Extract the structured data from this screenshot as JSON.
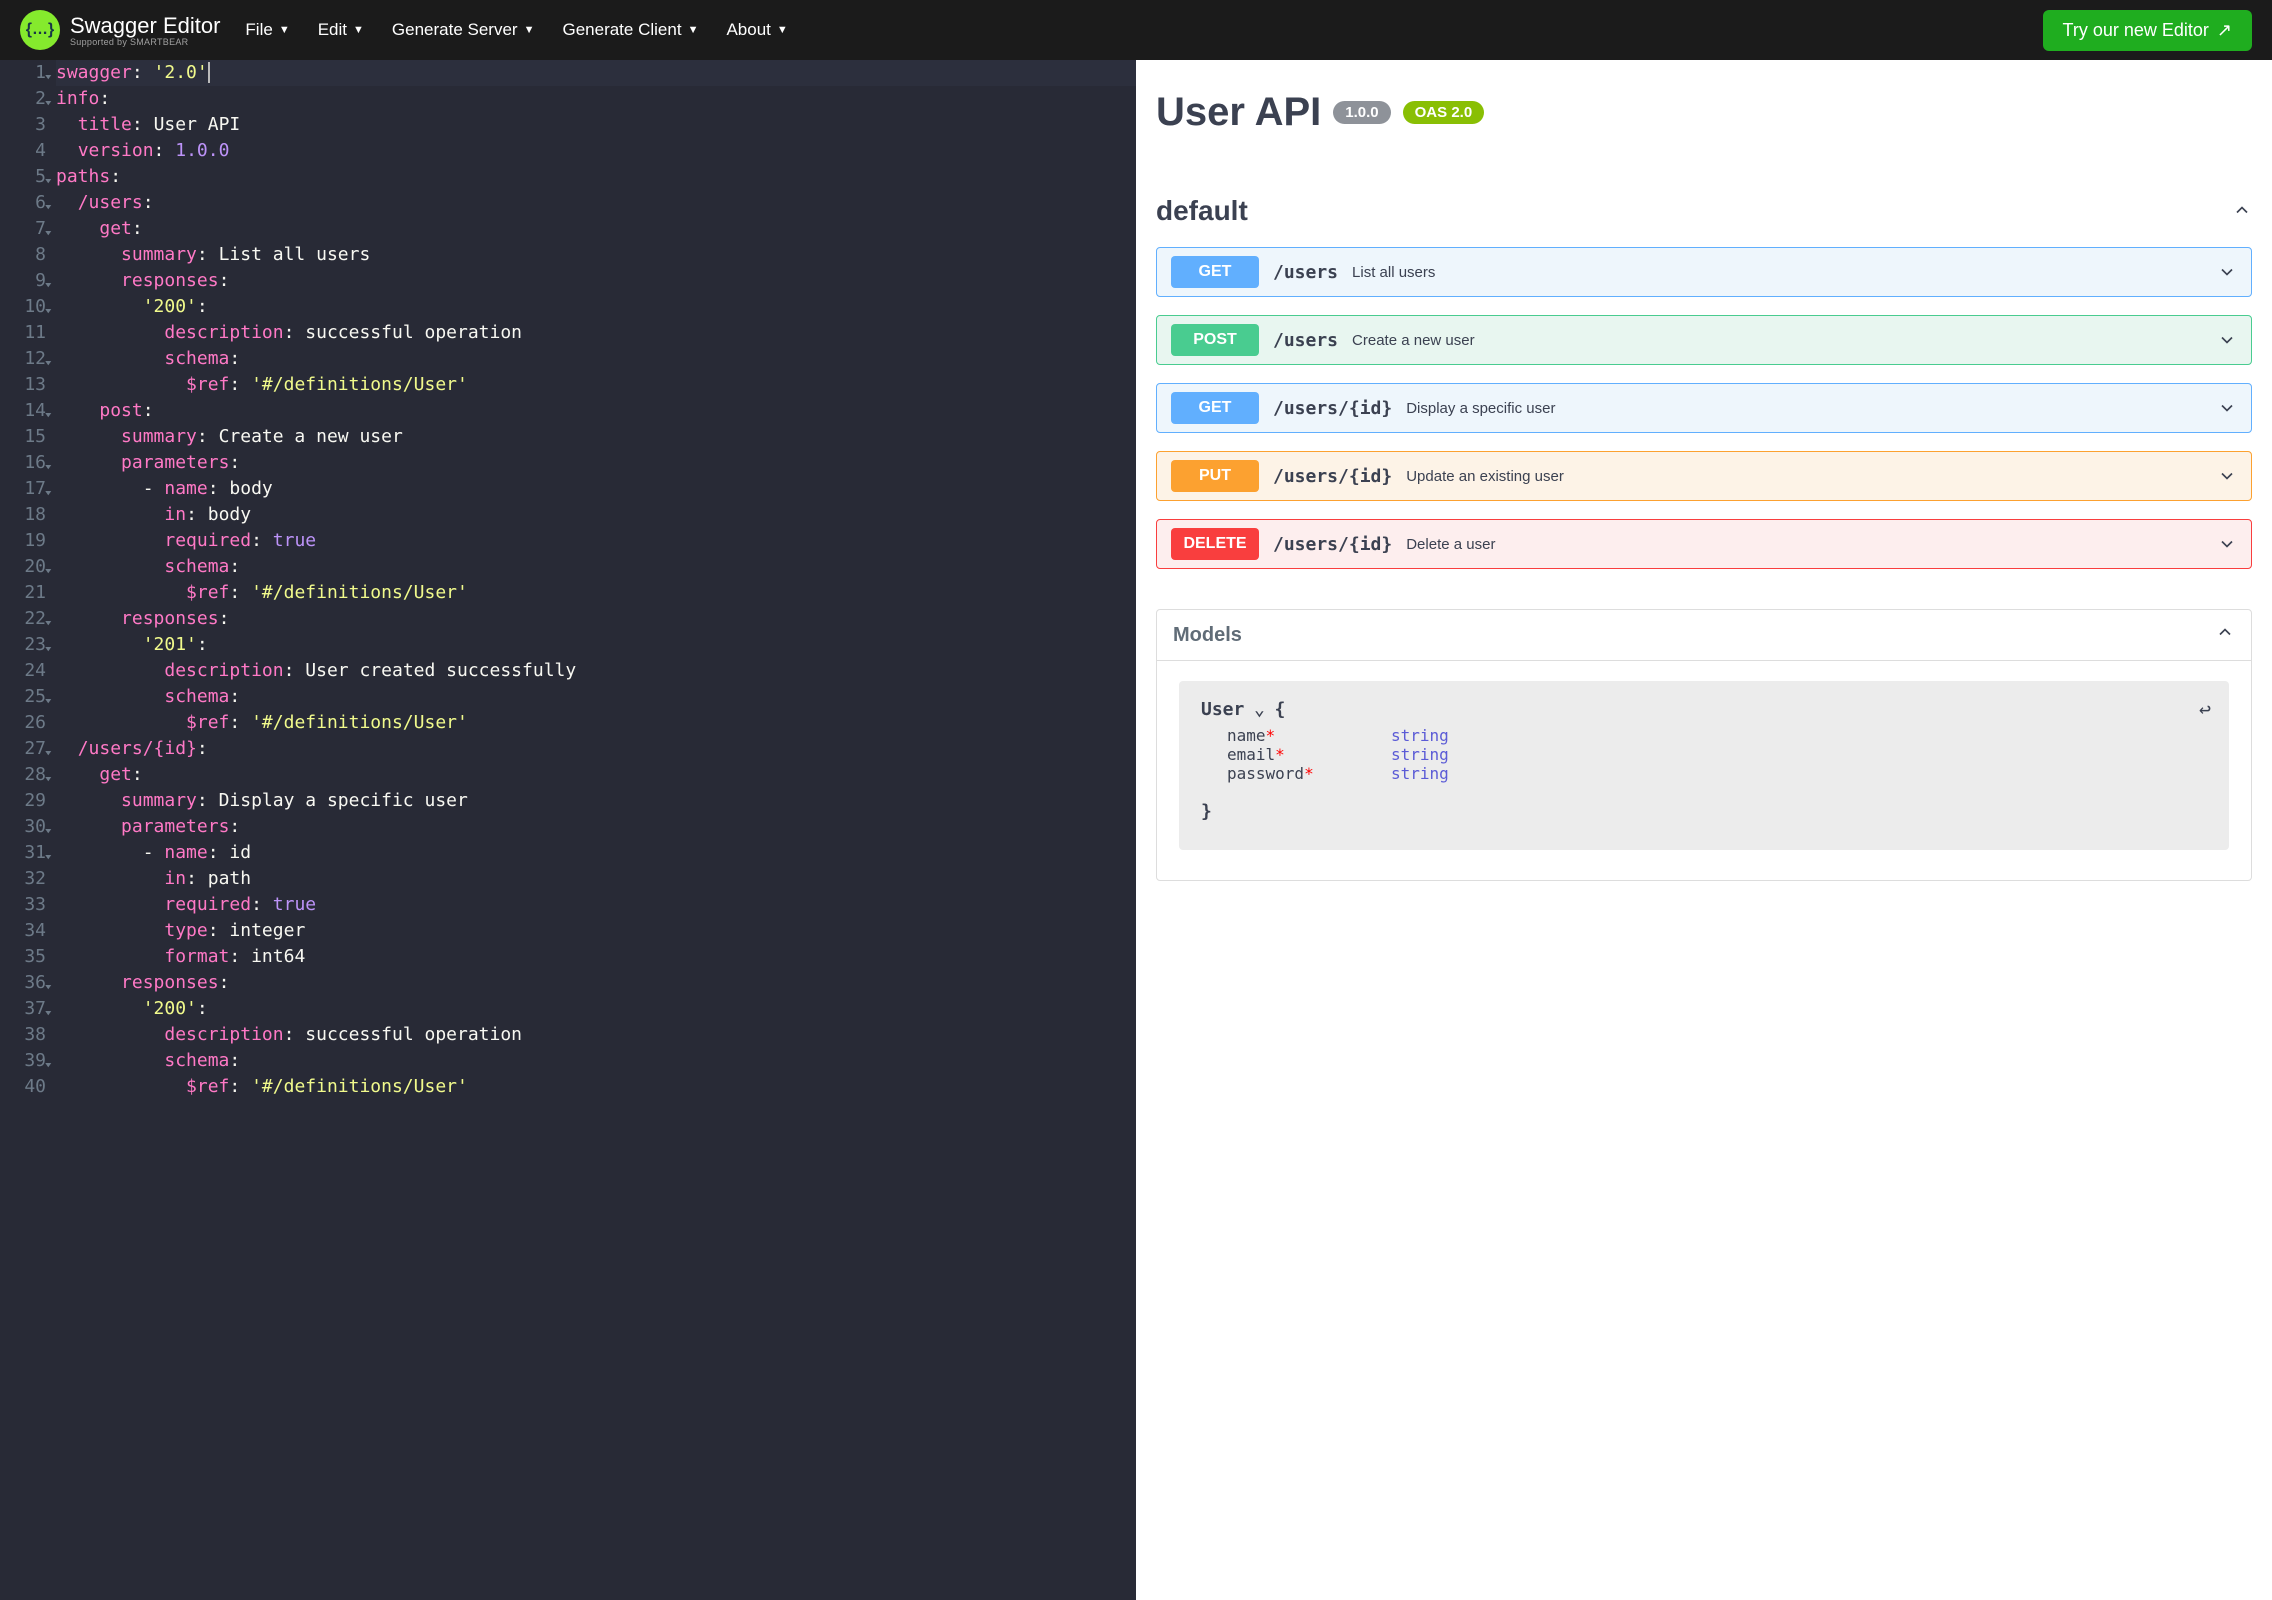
{
  "header": {
    "brand": "Swagger Editor",
    "brand_sub": "Supported by SMARTBEAR",
    "menu": [
      "File",
      "Edit",
      "Generate Server",
      "Generate Client",
      "About"
    ],
    "cta": "Try our new Editor"
  },
  "editor": {
    "lines": [
      {
        "n": 1,
        "f": 1,
        "h": 1,
        "html": "<span class='k'>swagger</span>: <span class='s'>'2.0'</span><span class='cursor'></span>"
      },
      {
        "n": 2,
        "f": 1,
        "html": "<span class='k'>info</span>:"
      },
      {
        "n": 3,
        "f": 0,
        "html": "  <span class='k'>title</span>: <span class='v'>User API</span>"
      },
      {
        "n": 4,
        "f": 0,
        "html": "  <span class='k'>version</span>: <span class='num'>1.0.0</span>"
      },
      {
        "n": 5,
        "f": 1,
        "html": "<span class='k'>paths</span>:"
      },
      {
        "n": 6,
        "f": 1,
        "html": "  <span class='k'>/users</span>:"
      },
      {
        "n": 7,
        "f": 1,
        "html": "    <span class='k'>get</span>:"
      },
      {
        "n": 8,
        "f": 0,
        "html": "      <span class='k'>summary</span>: <span class='v'>List all users</span>"
      },
      {
        "n": 9,
        "f": 1,
        "html": "      <span class='k'>responses</span>:"
      },
      {
        "n": 10,
        "f": 1,
        "html": "        <span class='s'>'200'</span>:"
      },
      {
        "n": 11,
        "f": 0,
        "html": "          <span class='k'>description</span>: <span class='v'>successful operation</span>"
      },
      {
        "n": 12,
        "f": 1,
        "html": "          <span class='k'>schema</span>:"
      },
      {
        "n": 13,
        "f": 0,
        "html": "            <span class='k'>$ref</span>: <span class='s'>'#/definitions/User'</span>"
      },
      {
        "n": 14,
        "f": 1,
        "html": "    <span class='k'>post</span>:"
      },
      {
        "n": 15,
        "f": 0,
        "html": "      <span class='k'>summary</span>: <span class='v'>Create a new user</span>"
      },
      {
        "n": 16,
        "f": 1,
        "html": "      <span class='k'>parameters</span>:"
      },
      {
        "n": 17,
        "f": 1,
        "html": "        - <span class='k'>name</span>: <span class='v'>body</span>"
      },
      {
        "n": 18,
        "f": 0,
        "html": "          <span class='k'>in</span>: <span class='v'>body</span>"
      },
      {
        "n": 19,
        "f": 0,
        "html": "          <span class='k'>required</span>: <span class='b'>true</span>"
      },
      {
        "n": 20,
        "f": 1,
        "html": "          <span class='k'>schema</span>:"
      },
      {
        "n": 21,
        "f": 0,
        "html": "            <span class='k'>$ref</span>: <span class='s'>'#/definitions/User'</span>"
      },
      {
        "n": 22,
        "f": 1,
        "html": "      <span class='k'>responses</span>:"
      },
      {
        "n": 23,
        "f": 1,
        "html": "        <span class='s'>'201'</span>:"
      },
      {
        "n": 24,
        "f": 0,
        "html": "          <span class='k'>description</span>: <span class='v'>User created successfully</span>"
      },
      {
        "n": 25,
        "f": 1,
        "html": "          <span class='k'>schema</span>:"
      },
      {
        "n": 26,
        "f": 0,
        "html": "            <span class='k'>$ref</span>: <span class='s'>'#/definitions/User'</span>"
      },
      {
        "n": 27,
        "f": 1,
        "html": "  <span class='k'>/users/{id}</span>:"
      },
      {
        "n": 28,
        "f": 1,
        "html": "    <span class='k'>get</span>:"
      },
      {
        "n": 29,
        "f": 0,
        "html": "      <span class='k'>summary</span>: <span class='v'>Display a specific user</span>"
      },
      {
        "n": 30,
        "f": 1,
        "html": "      <span class='k'>parameters</span>:"
      },
      {
        "n": 31,
        "f": 1,
        "html": "        - <span class='k'>name</span>: <span class='v'>id</span>"
      },
      {
        "n": 32,
        "f": 0,
        "html": "          <span class='k'>in</span>: <span class='v'>path</span>"
      },
      {
        "n": 33,
        "f": 0,
        "html": "          <span class='k'>required</span>: <span class='b'>true</span>"
      },
      {
        "n": 34,
        "f": 0,
        "html": "          <span class='k'>type</span>: <span class='v'>integer</span>"
      },
      {
        "n": 35,
        "f": 0,
        "html": "          <span class='k'>format</span>: <span class='v'>int64</span>"
      },
      {
        "n": 36,
        "f": 1,
        "html": "      <span class='k'>responses</span>:"
      },
      {
        "n": 37,
        "f": 1,
        "html": "        <span class='s'>'200'</span>:"
      },
      {
        "n": 38,
        "f": 0,
        "html": "          <span class='k'>description</span>: <span class='v'>successful operation</span>"
      },
      {
        "n": 39,
        "f": 1,
        "html": "          <span class='k'>schema</span>:"
      },
      {
        "n": 40,
        "f": 0,
        "html": "            <span class='k'>$ref</span>: <span class='s'>'#/definitions/User'</span>"
      }
    ]
  },
  "preview": {
    "title": "User API",
    "version_badge": "1.0.0",
    "oas_badge": "OAS 2.0",
    "section": "default",
    "operations": [
      {
        "method": "GET",
        "cls": "op-get",
        "path": "/users",
        "summary": "List all users"
      },
      {
        "method": "POST",
        "cls": "op-post",
        "path": "/users",
        "summary": "Create a new user"
      },
      {
        "method": "GET",
        "cls": "op-get",
        "path": "/users/{id}",
        "summary": "Display a specific user"
      },
      {
        "method": "PUT",
        "cls": "op-put",
        "path": "/users/{id}",
        "summary": "Update an existing user"
      },
      {
        "method": "DELETE",
        "cls": "op-delete",
        "path": "/users/{id}",
        "summary": "Delete a user"
      }
    ],
    "models_title": "Models",
    "model": {
      "name": "User",
      "props": [
        {
          "name": "name",
          "type": "string",
          "req": true
        },
        {
          "name": "email",
          "type": "string",
          "req": true
        },
        {
          "name": "password",
          "type": "string",
          "req": true
        }
      ]
    }
  }
}
